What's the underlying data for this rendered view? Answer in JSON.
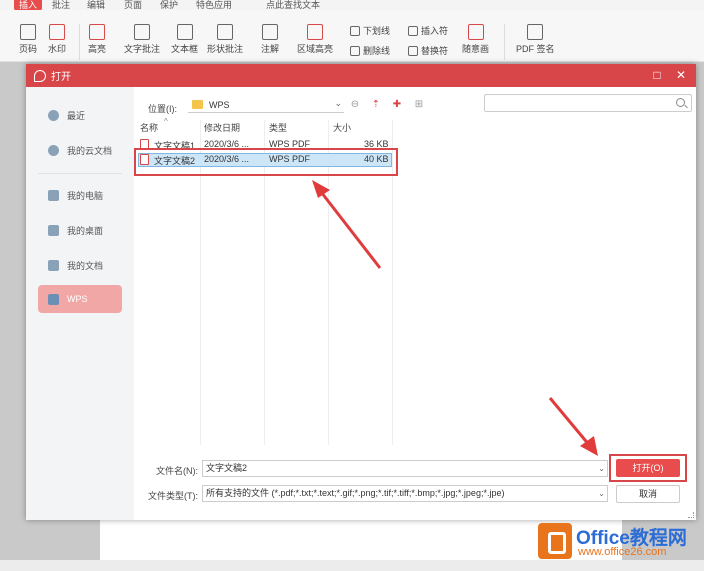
{
  "menu": [
    "插入",
    "批注",
    "编辑",
    "页面",
    "保护",
    "特色应用",
    "点此查找文本"
  ],
  "ribbon": {
    "page_number": "页码",
    "watermark": "水印",
    "highlight": "高亮",
    "text_comment": "文字批注",
    "text_box": "文本框",
    "shape_comment": "形状批注",
    "note": "注解",
    "area_highlight": "区域高亮",
    "underline": "下划线",
    "strikethrough": "删除线",
    "insert_char": "插入符",
    "replace_char": "替换符",
    "scribble": "随意画",
    "pdf_sign": "PDF 签名"
  },
  "dialog": {
    "title": "打开",
    "sidebar": [
      "最近",
      "我的云文档",
      "我的电脑",
      "我的桌面",
      "我的文档",
      "WPS"
    ],
    "location_label": "位置(I):",
    "location_value": "WPS",
    "columns": [
      "名称",
      "修改日期",
      "类型",
      "大小"
    ],
    "files": [
      {
        "name": "文字文稿1",
        "date": "2020/3/6 ...",
        "type": "WPS PDF",
        "size": "36 KB"
      },
      {
        "name": "文字文稿2",
        "date": "2020/3/6 ...",
        "type": "WPS PDF",
        "size": "40 KB"
      }
    ],
    "filename_label": "文件名(N):",
    "filename_value": "文字文稿2",
    "filetype_label": "文件类型(T):",
    "filetype_value": "所有支持的文件 (*.pdf;*.txt;*.text;*.gif;*.png;*.tif;*.tiff;*.bmp;*.jpg;*.jpeg;*.jpe)",
    "open_button": "打开(O)",
    "cancel_button": "取消"
  },
  "watermark": {
    "title": "Office教程网",
    "url": "www.office26.com"
  },
  "colors": {
    "accent": "#d9464a",
    "selection": "#cde6f7",
    "sidebar_active": "#f2a7a7"
  }
}
